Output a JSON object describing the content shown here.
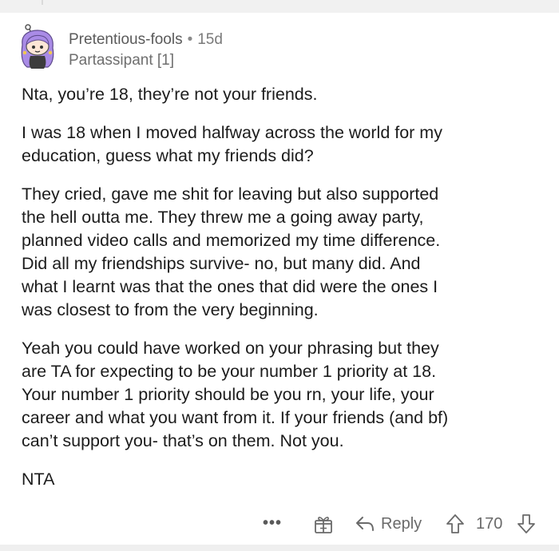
{
  "comment": {
    "username": "Pretentious-fools",
    "separator": "•",
    "age": "15d",
    "flair": "Partassipant [1]",
    "paragraphs": [
      "Nta, you’re 18, they’re not your friends.",
      "I was 18 when I moved halfway across the world for my\neducation, guess what my friends did?",
      "They cried, gave me shit for leaving but also supported\nthe hell outta me. They threw me a going away party,\nplanned video calls and memorized my time difference.\nDid all my friendships survive- no, but many did. And\nwhat I learnt was that the ones that did were the ones I\nwas closest to from the very beginning.",
      "Yeah you could have worked on your phrasing but they\nare TA for expecting to be your number 1 priority at 18.\nYour number 1 priority should be you rn, your life, your\ncareer and what you want from it. If your friends (and bf)\ncan’t support you- that’s on them. Not you.",
      "NTA"
    ]
  },
  "actions": {
    "more_label": "•••",
    "reply_label": "Reply",
    "score": "170"
  },
  "icons": {
    "avatar": "avatar-snoo-purple-hair",
    "award": "gift-award-icon",
    "reply": "reply-arrow-icon",
    "upvote": "upvote-arrow-icon",
    "downvote": "downvote-arrow-icon"
  },
  "colors": {
    "avatar_hair": "#a98be6",
    "text": "#1c1c1c",
    "meta": "#5a5a5a"
  }
}
